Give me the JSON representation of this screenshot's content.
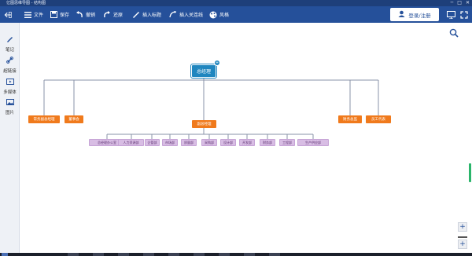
{
  "window": {
    "title": "亿图思维导图 - 结构图",
    "controls": [
      "─",
      "□",
      "✕"
    ]
  },
  "toolbar": {
    "items": [
      {
        "label": "文件",
        "icon": "menu-icon"
      },
      {
        "label": "保存",
        "icon": "save-icon"
      },
      {
        "label": "撤销",
        "icon": "undo-icon"
      },
      {
        "label": "还原",
        "icon": "redo-icon"
      },
      {
        "label": "插入标题",
        "icon": "insert-topic-icon"
      },
      {
        "label": "插入关连线",
        "icon": "insert-relation-icon"
      },
      {
        "label": "风格",
        "icon": "palette-icon"
      }
    ],
    "login_label": "登录/注册"
  },
  "sidebar": {
    "items": [
      {
        "label": "笔记",
        "icon": "pen-icon"
      },
      {
        "label": "超链接",
        "icon": "link-icon"
      },
      {
        "label": "多媒体",
        "icon": "media-icon"
      },
      {
        "label": "图片",
        "icon": "image-icon"
      }
    ]
  },
  "mindmap": {
    "root": "总经理",
    "root_badge": "+",
    "branches": [
      "常务副总经理",
      "董事会",
      "副总经理",
      "财务总监",
      "员工代表"
    ],
    "sub_nodes": [
      "总经理办公室",
      "人力资源部",
      "企管部",
      "市场部",
      "质量部",
      "采购部",
      "设计部",
      "开发部",
      "财务部",
      "工程部",
      "生产供应部"
    ]
  },
  "zoom": {
    "in": "+",
    "out": "+"
  },
  "colors": {
    "toolbar": "#25509a",
    "root": "#1f86bf",
    "branch": "#f07a1c",
    "sub": "#d8bde4"
  }
}
